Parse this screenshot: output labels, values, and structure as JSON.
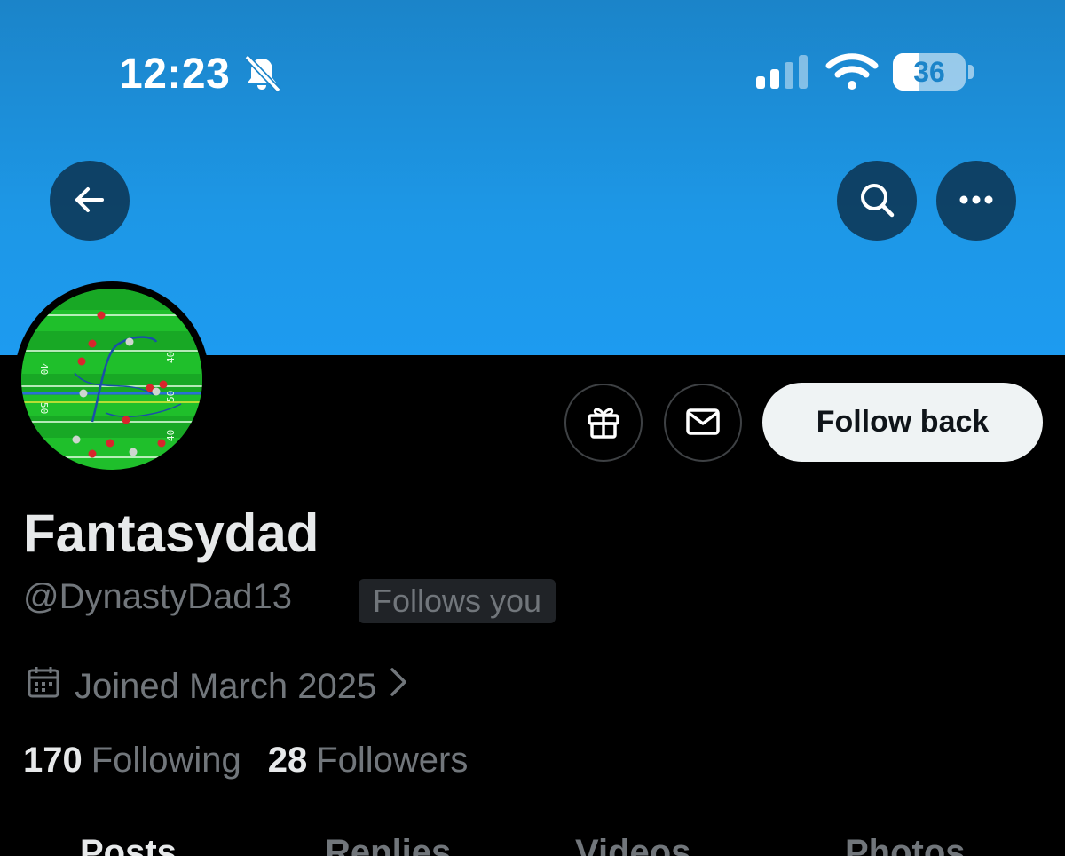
{
  "status_bar": {
    "time": "12:23",
    "battery_level": "36",
    "battery_percent": 36
  },
  "icons": {
    "bell": "bell-slash-icon",
    "signal": "cellular-signal-icon",
    "wifi": "wifi-icon",
    "back": "arrow-left-icon",
    "search": "search-icon",
    "more": "ellipsis-icon",
    "gift": "gift-icon",
    "mail": "envelope-icon",
    "calendar": "calendar-icon",
    "chevron": "chevron-right-icon"
  },
  "colors": {
    "banner": "#1d9bf0",
    "background": "#000000",
    "primary_text": "#e7e9ea",
    "secondary_text": "#71767b",
    "follow_button": "#eff3f4"
  },
  "profile": {
    "display_name": "Fantasydad",
    "handle": "@DynastyDad13",
    "follows_you_badge": "Follows you",
    "joined": "Joined March 2025",
    "follow_button_label": "Follow back"
  },
  "stats": {
    "following_count": "170",
    "following_label": "Following",
    "followers_count": "28",
    "followers_label": "Followers"
  },
  "tabs": [
    {
      "label": "Posts",
      "active": true
    },
    {
      "label": "Replies",
      "active": false
    },
    {
      "label": "Videos",
      "active": false
    },
    {
      "label": "Photos",
      "active": false
    }
  ]
}
